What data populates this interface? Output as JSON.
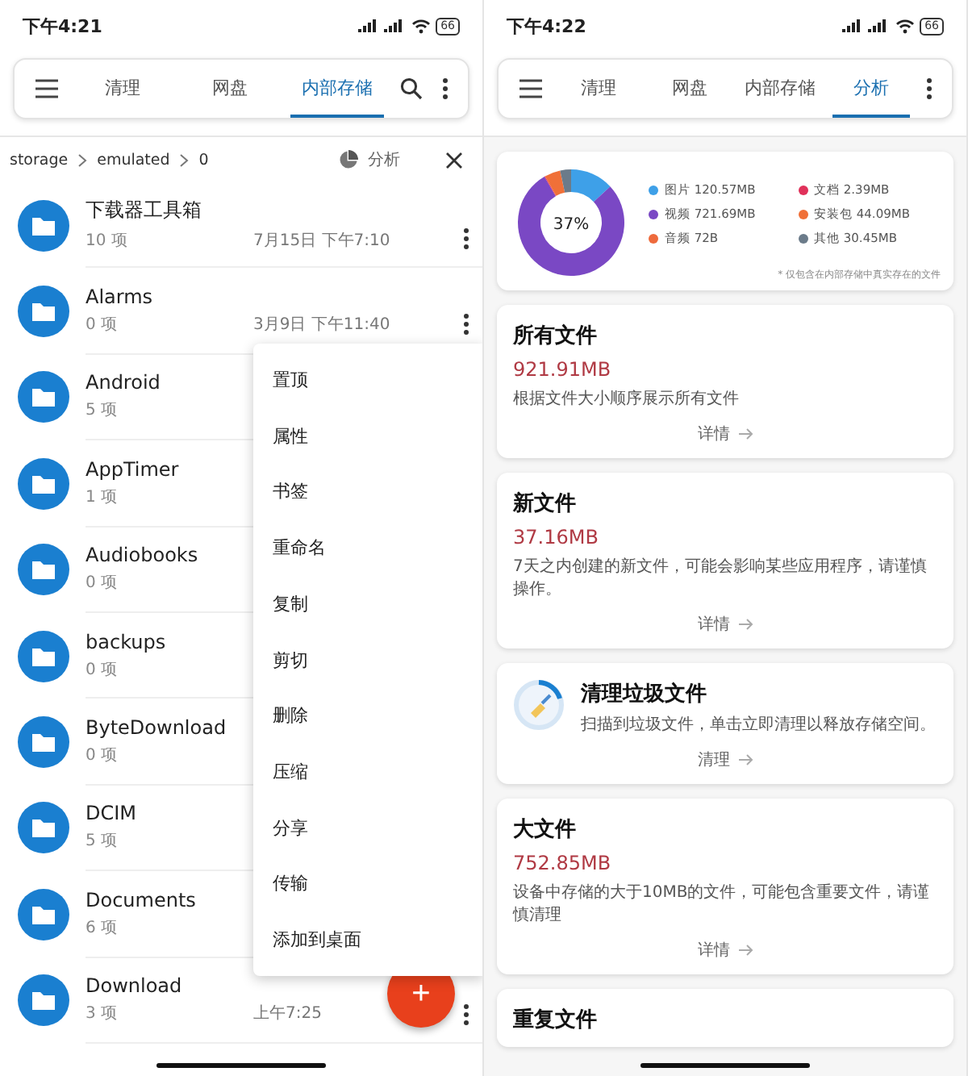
{
  "left": {
    "status_bar": {
      "time": "下午4:21",
      "battery": "66"
    },
    "tabs": [
      {
        "label": "清理",
        "selected": false
      },
      {
        "label": "网盘",
        "selected": false
      },
      {
        "label": "内部存储",
        "selected": true
      }
    ],
    "breadcrumb": [
      "storage",
      "emulated",
      "0"
    ],
    "analyze_button": "分析",
    "files": [
      {
        "name": "下载器工具箱",
        "count": "10 项",
        "date": "7月15日 下午7:10",
        "more_button": true
      },
      {
        "name": "Alarms",
        "count": "0 项",
        "date": "3月9日 下午11:40",
        "more_button": true
      },
      {
        "name": "Android",
        "count": "5 项",
        "more_button": false
      },
      {
        "name": "AppTimer",
        "count": "1 项",
        "more_button": false
      },
      {
        "name": "Audiobooks",
        "count": "0 项",
        "more_button": false
      },
      {
        "name": "backups",
        "count": "0 项",
        "more_button": false
      },
      {
        "name": "ByteDownload",
        "count": "0 项",
        "more_button": false
      },
      {
        "name": "DCIM",
        "count": "5 项",
        "more_button": false
      },
      {
        "name": "Documents",
        "count": "6 项",
        "more_button": false
      },
      {
        "name": "Download",
        "count": "3 项",
        "date": "上午7:25",
        "more_button": true
      }
    ],
    "context_menu": [
      "置顶",
      "属性",
      "书签",
      "重命名",
      "复制",
      "剪切",
      "删除",
      "压缩",
      "分享",
      "传输",
      "添加到桌面"
    ],
    "fab": "+"
  },
  "right": {
    "status_bar": {
      "time": "下午4:22",
      "battery": "66"
    },
    "tabs": [
      {
        "label": "清理",
        "selected": false
      },
      {
        "label": "网盘",
        "selected": false
      },
      {
        "label": "内部存储",
        "selected": false
      },
      {
        "label": "分析",
        "selected": true
      }
    ],
    "usage": {
      "center_label": "37%",
      "note": "* 仅包含在内部存储中真实存在的文件",
      "legend": [
        {
          "size": "120.57MB",
          "color": "#3ea0e8"
        },
        {
          "size": "721.69MB",
          "color": "#7a48c4"
        },
        {
          "size": "72B",
          "color": "#ee6a3c"
        },
        {
          "size": "2.39MB",
          "color": "#e0315a"
        },
        {
          "size": "44.09MB",
          "color": "#f07038"
        },
        {
          "size": "30.45MB",
          "color": "#6b7b8a"
        }
      ],
      "chart_data": {
        "type": "donut",
        "categories": [
          "图片",
          "视频",
          "音频",
          "文档",
          "安装包",
          "其他"
        ],
        "values": [
          13.12,
          78.51,
          0,
          0.26,
          4.8,
          3.31
        ]
      }
    },
    "cards": [
      {
        "kind": "stat",
        "title": "所有文件",
        "size": "921.91MB",
        "description": "根据文件大小顺序展示所有文件",
        "action": "详情"
      },
      {
        "kind": "stat",
        "title": "新文件",
        "size": "37.16MB",
        "description": "7天之内创建的新文件，可能会影响某些应用程序，请谨慎操作。",
        "action": "详情"
      },
      {
        "kind": "clean",
        "title": "清理垃圾文件",
        "description": "扫描到垃圾文件，单击立即清理以释放存储空间。",
        "action": "清理"
      },
      {
        "kind": "stat",
        "title": "大文件",
        "size": "752.85MB",
        "description": "设备中存储的大于10MB的文件，可能包含重要文件，请谨慎清理",
        "action": "详情"
      },
      {
        "kind": "stat",
        "title": "重复文件"
      }
    ]
  }
}
